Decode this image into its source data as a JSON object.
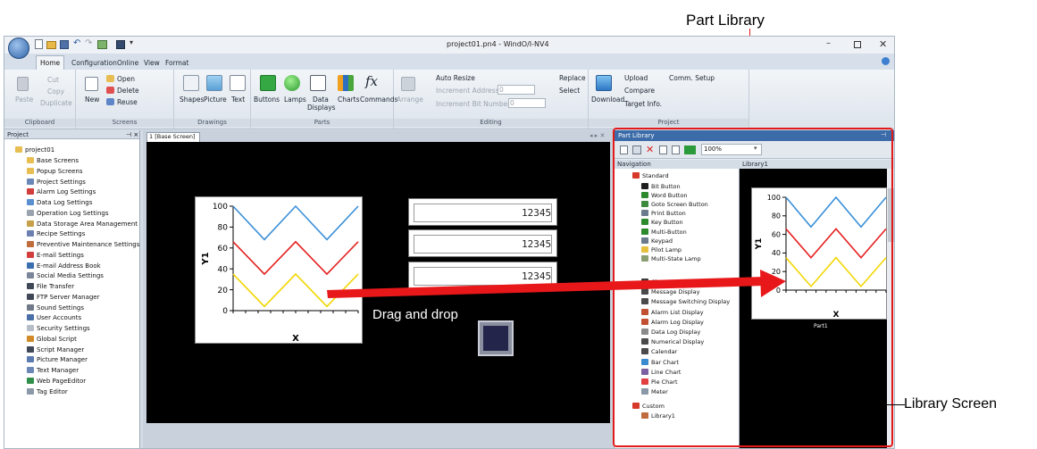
{
  "annotations": {
    "part_library": "Part Library",
    "library_screen": "Library Screen",
    "drag_drop": "Drag and drop"
  },
  "window": {
    "title": "project01.pn4 - WindO/I-NV4",
    "tabs": [
      "Home",
      "Configuration",
      "Online",
      "View",
      "Format"
    ]
  },
  "ribbon": {
    "clipboard": {
      "cut": "Cut",
      "copy": "Copy",
      "paste": "Paste",
      "duplicate": "Duplicate",
      "label": "Clipboard"
    },
    "screens": {
      "new": "New",
      "open": "Open",
      "delete": "Delete",
      "reuse": "Reuse",
      "label": "Screens"
    },
    "drawings": {
      "shapes": "Shapes",
      "picture": "Picture",
      "text": "Text",
      "label": "Drawings"
    },
    "parts": {
      "buttons": "Buttons",
      "lamps": "Lamps",
      "data_displays_1": "Data",
      "data_displays_2": "Displays",
      "charts": "Charts",
      "commands": "Commands",
      "label": "Parts"
    },
    "editing": {
      "arrange": "Arrange",
      "auto_resize": "Auto Resize",
      "inc_address": "Increment Address",
      "inc_address_val": "0",
      "inc_bit": "Increment Bit Number",
      "inc_bit_val": "0",
      "replace": "Replace",
      "select": "Select",
      "label": "Editing"
    },
    "project": {
      "download": "Download",
      "upload": "Upload",
      "compare": "Compare",
      "target_info": "Target Info.",
      "comm_setup": "Comm. Setup",
      "label": "Project"
    }
  },
  "project_pane": {
    "title": "Project",
    "root": "project01",
    "items": [
      "Base Screens",
      "Popup Screens",
      "Project Settings",
      "Alarm Log Settings",
      "Data Log Settings",
      "Operation Log Settings",
      "Data Storage Area Management",
      "Recipe Settings",
      "Preventive Maintenance Settings",
      "E-mail Settings",
      "E-mail Address Book",
      "Social Media Settings",
      "File Transfer",
      "FTP Server Manager",
      "Sound Settings",
      "User Accounts",
      "Security Settings",
      "Global Script",
      "Script Manager",
      "Picture Manager",
      "Text Manager",
      "Web PageEditor",
      "Tag Editor"
    ]
  },
  "editor": {
    "tab": "1 [Base Screen]",
    "numeric_values": [
      "12345",
      "12345",
      "12345"
    ]
  },
  "chart_data": {
    "type": "line",
    "ylabel": "Y1",
    "xlabel": "X",
    "ylim": [
      0,
      100
    ],
    "yticks": [
      0,
      20,
      40,
      60,
      80,
      100
    ],
    "x": [
      0,
      1,
      2,
      3,
      4
    ],
    "series": [
      {
        "color": "#3a8fd8",
        "values": [
          100,
          68,
          100,
          68,
          100
        ]
      },
      {
        "color": "#e52020",
        "values": [
          66,
          35,
          66,
          35,
          66
        ]
      },
      {
        "color": "#f2d600",
        "values": [
          35,
          4,
          35,
          4,
          35
        ]
      }
    ]
  },
  "library_pane": {
    "title": "Part Library",
    "zoom": "100%",
    "nav_header": "Navigation",
    "lib_header": "Library1",
    "standard": "Standard",
    "nav_items": [
      "Bit Button",
      "Word Button",
      "Goto Screen Button",
      "Print Button",
      "Key Button",
      "Multi-Button",
      "Keypad",
      "Pilot Lamp",
      "Multi-State Lamp"
    ],
    "nav_items2": [
      "Character Input",
      "Message Display",
      "Message Switching Display",
      "Alarm List Display",
      "Alarm Log Display",
      "Data Log Display",
      "Numerical Display",
      "Calendar",
      "Bar Chart",
      "Line Chart",
      "Pie Chart",
      "Meter"
    ],
    "custom": "Custom",
    "library1": "Library1",
    "part_caption": "Part1"
  }
}
